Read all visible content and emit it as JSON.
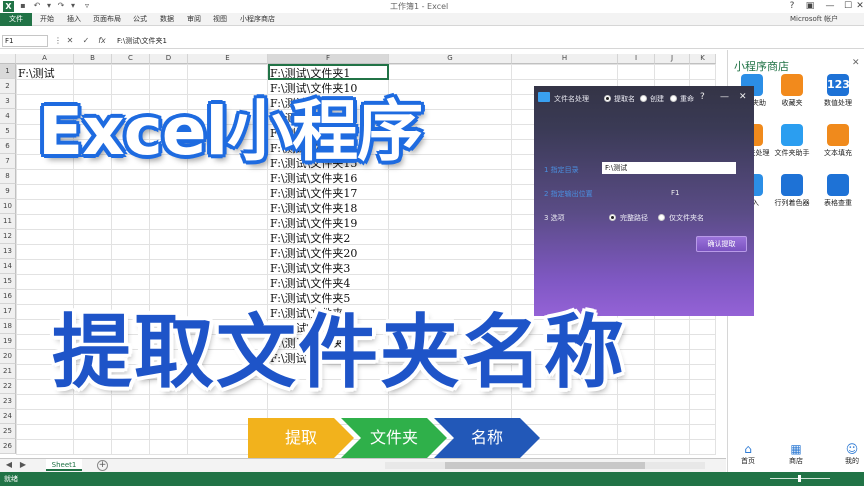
{
  "window": {
    "title": "工作簿1 - Excel",
    "account": "Microsoft 帐户",
    "logo": "X"
  },
  "ribbon": {
    "tabs": [
      "文件",
      "开始",
      "插入",
      "页面布局",
      "公式",
      "数据",
      "审阅",
      "视图",
      "小程序商店"
    ]
  },
  "formula_bar": {
    "name_box": "F1",
    "fx": "fx",
    "content": "F:\\测试\\文件夹1"
  },
  "grid": {
    "columns": [
      "A",
      "B",
      "C",
      "D",
      "E",
      "F",
      "G",
      "H",
      "I",
      "J",
      "K"
    ],
    "rows": [
      "1",
      "2",
      "3",
      "4",
      "5",
      "6",
      "7",
      "8",
      "9",
      "10",
      "11",
      "12",
      "13",
      "14",
      "15",
      "16",
      "17",
      "18",
      "19",
      "20",
      "21",
      "22",
      "23",
      "24",
      "25",
      "26"
    ],
    "cell_a1": "F:\\测试",
    "column_f": [
      "F:\\测试\\文件夹1",
      "F:\\测试\\文件夹10",
      "F:\\测试\\文件夹11",
      "F:\\测试\\文件夹12",
      "F:\\测试\\文件夹13",
      "F:\\测试\\文件夹14",
      "F:\\测试\\文件夹15",
      "F:\\测试\\文件夹16",
      "F:\\测试\\文件夹17",
      "F:\\测试\\文件夹18",
      "F:\\测试\\文件夹19",
      "F:\\测试\\文件夹2",
      "F:\\测试\\文件夹20",
      "F:\\测试\\文件夹3",
      "F:\\测试\\文件夹4",
      "F:\\测试\\文件夹5",
      "F:\\测试\\文件夹6",
      "F:\\测试\\文件夹7",
      "F:\\测试\\文件夹8",
      "F:\\测试\\文件夹9"
    ]
  },
  "sheets": {
    "active": "Sheet1"
  },
  "status": {
    "text": "就绪"
  },
  "side_panel": {
    "title": "小程序商店",
    "tiles": [
      {
        "label": "文件夹助",
        "icon": "folder-icon",
        "color": "#2b8ee6"
      },
      {
        "label": "收藏夹",
        "icon": "star-icon",
        "color": "#f28a1c"
      },
      {
        "label": "数值处理",
        "icon": "number-123-icon",
        "color": "#1e72d6",
        "glyph": "123"
      },
      {
        "label": "文件夹处理",
        "icon": "folder-process-icon",
        "color": "#f08a1c"
      },
      {
        "label": "文件夹助手",
        "icon": "folder-helper-icon",
        "color": "#2b9ef0"
      },
      {
        "label": "文本填充",
        "icon": "text-fill-icon",
        "color": "#f08a1c"
      },
      {
        "label": "导入",
        "icon": "import-icon",
        "color": "#2b8ee6"
      },
      {
        "label": "行列着色器",
        "icon": "paint-bucket-icon",
        "color": "#1e72d6"
      },
      {
        "label": "表格查重",
        "icon": "table-dedupe-icon",
        "color": "#1e72d6"
      }
    ],
    "nav": [
      {
        "label": "首页",
        "icon": "home-icon"
      },
      {
        "label": "商店",
        "icon": "store-grid-icon"
      },
      {
        "label": "我的",
        "icon": "user-icon"
      }
    ]
  },
  "dialog": {
    "title": "文件名处理",
    "mode_options": [
      "提取名",
      "创建",
      "重命"
    ],
    "mode_selected": 0,
    "help": "?",
    "minimize": "—",
    "close": "✕",
    "field1_label": "1 指定目录",
    "field1_value": "F:\\测试",
    "field2_label": "2 指定输出位置",
    "field2_value": "F1",
    "field3_label": "3 选项",
    "option_full_path": "完整路径",
    "option_name_only": "仅文件夹名",
    "option_selected": 0,
    "confirm": "确认提取"
  },
  "overlay": {
    "title": "Excel小程序",
    "subtitle": "提取文件夹名称",
    "steps": [
      {
        "label": "提取",
        "color": "#f2b21c"
      },
      {
        "label": "文件夹",
        "color": "#2fb04a"
      },
      {
        "label": "名称",
        "color": "#2258b8"
      }
    ]
  }
}
